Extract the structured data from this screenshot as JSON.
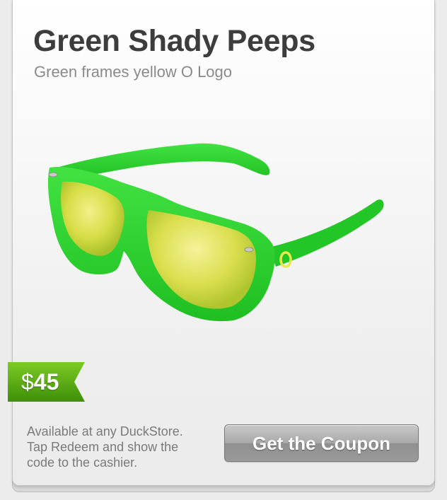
{
  "product": {
    "title": "Green Shady Peeps",
    "subtitle": "Green frames yellow O Logo",
    "price_currency": "$",
    "price_amount": "45"
  },
  "availability": {
    "line1": "Available at any DuckStore.",
    "line2": "Tap Redeem and show the",
    "line3": "code to the cashier."
  },
  "actions": {
    "coupon_label": "Get the Coupon"
  },
  "colors": {
    "frame_green": "#2fd12f",
    "lens_yellow": "#d8e04a",
    "price_tag_green": "#5aa80f",
    "title_text": "#3d3d3d",
    "button_gray": "#a9a9a9"
  }
}
